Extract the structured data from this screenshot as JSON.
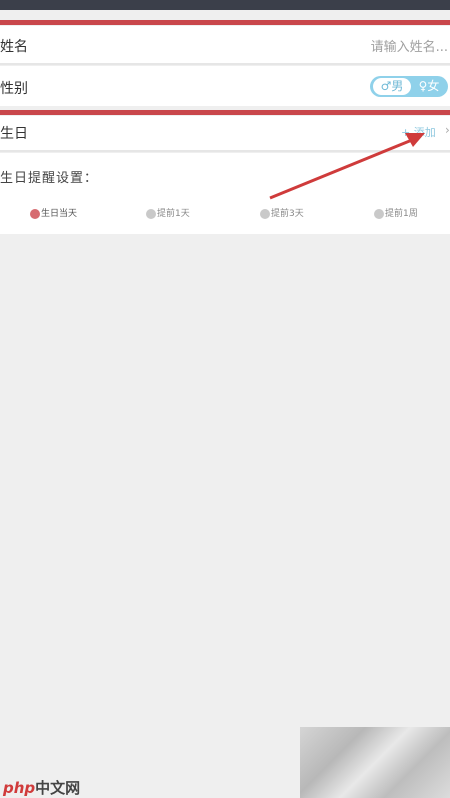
{
  "form": {
    "name": {
      "label": "姓名",
      "placeholder": "请输入姓名..."
    },
    "gender": {
      "label": "性别",
      "male": "男",
      "female": "女",
      "selected": "男"
    },
    "birthday": {
      "label": "生日",
      "add_label": "+ 添加",
      "chevron": "›"
    },
    "reminder": {
      "title": "生日提醒设置：",
      "options": [
        {
          "label": "生日当天",
          "checked": true
        },
        {
          "label": "提前1天",
          "checked": false
        },
        {
          "label": "提前3天",
          "checked": false
        },
        {
          "label": "提前1周",
          "checked": false
        }
      ]
    }
  },
  "watermark": {
    "brand": "php",
    "site": "中文网"
  },
  "colors": {
    "highlight": "#c9474b",
    "accent": "#8fd1ea",
    "checked": "#d66b70"
  }
}
